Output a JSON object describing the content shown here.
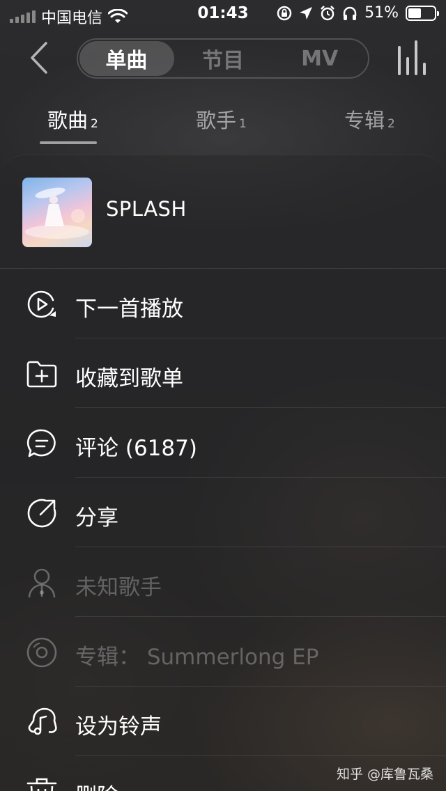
{
  "status_bar": {
    "carrier": "中国电信",
    "time": "01:43",
    "battery_pct": "51%",
    "battery_level": 0.51,
    "icons": [
      "signal-icon",
      "wifi-icon",
      "orientation-lock-icon",
      "location-icon",
      "alarm-icon",
      "headphones-icon",
      "battery-icon"
    ]
  },
  "header": {
    "back_icon": "back-chevron-icon",
    "segments": [
      {
        "label": "单曲",
        "active": true
      },
      {
        "label": "节目",
        "active": false
      },
      {
        "label": "MV",
        "active": false
      }
    ],
    "equalizer_icon": "equalizer-icon"
  },
  "subtabs": [
    {
      "label": "歌曲",
      "count": "2",
      "active": true
    },
    {
      "label": "歌手",
      "count": "1",
      "active": false
    },
    {
      "label": "专辑",
      "count": "2",
      "active": false
    }
  ],
  "song": {
    "title": "SPLASH"
  },
  "menu": [
    {
      "label": "下一首播放",
      "icon": "play-next-icon",
      "enabled": true
    },
    {
      "label": "收藏到歌单",
      "icon": "add-to-playlist-icon",
      "enabled": true
    },
    {
      "label": "评论 (6187)",
      "icon": "comment-icon",
      "enabled": true
    },
    {
      "label": "分享",
      "icon": "share-icon",
      "enabled": true
    },
    {
      "label": "未知歌手",
      "icon": "artist-icon",
      "enabled": false
    },
    {
      "label": "专辑：  Summerlong EP",
      "icon": "album-icon",
      "enabled": false
    },
    {
      "label": "设为铃声",
      "icon": "ringtone-icon",
      "enabled": true
    },
    {
      "label": "删除",
      "icon": "trash-icon",
      "enabled": true
    }
  ],
  "watermark": "知乎 @库鲁瓦桑"
}
